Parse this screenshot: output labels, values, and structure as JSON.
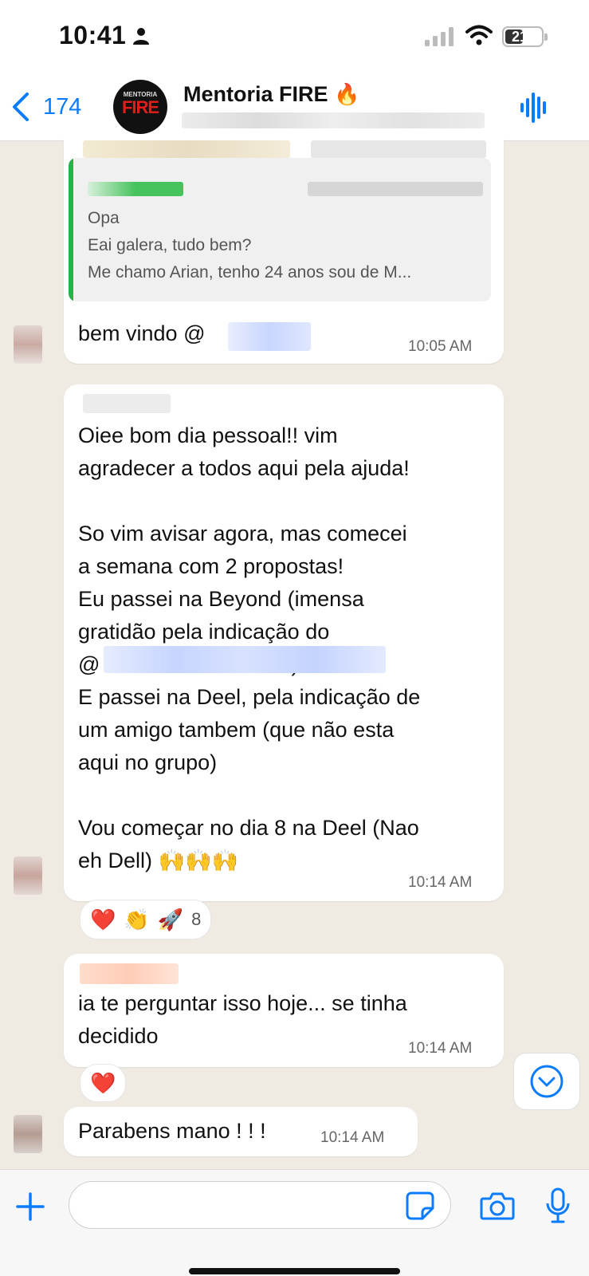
{
  "status_bar": {
    "time": "10:41",
    "battery": "21"
  },
  "header": {
    "back_count": "174",
    "avatar_top": "MENTORIA",
    "avatar_word": "FIRE",
    "group_name": "Mentoria FIRE",
    "group_emoji": "🔥"
  },
  "messages": {
    "m1": {
      "quote_lines": [
        "Opa",
        "Eai galera, tudo bem?",
        "Me chamo Arian, tenho 24 anos sou de M..."
      ],
      "text": "bem vindo @",
      "time": "10:05 AM"
    },
    "m2": {
      "text": "Oiee bom dia pessoal!! vim\nagradecer a todos aqui pela ajuda!\n\nSo vim avisar agora, mas comecei\na semana com 2 propostas!\nEu passei na Beyond (imensa\ngratidão pela indicação do\n@                                )\nE passei na Deel, pela indicação de\num amigo tambem (que não esta\naqui no grupo)\n\nVou começar no dia 8 na Deel (Nao\neh Dell) 🙌🙌🙌",
      "time": "10:14 AM",
      "reactions": [
        "❤️",
        "👏",
        "🚀"
      ],
      "reaction_count": "8"
    },
    "m3": {
      "text": "ia te perguntar isso hoje... se tinha\ndecidido",
      "time": "10:14 AM",
      "reactions": [
        "❤️"
      ]
    },
    "m4": {
      "text": "Parabens mano ! ! !",
      "time": "10:14 AM"
    }
  },
  "colors": {
    "accent": "#0a7cff",
    "chat_bg": "#efeae2",
    "quote_bar": "#25b34a"
  },
  "icons": [
    "person-icon",
    "signal-icon",
    "wifi-icon",
    "battery-icon",
    "back-chevron-icon",
    "voice-icon",
    "scroll-down-icon",
    "plus-icon",
    "sticker-icon",
    "camera-icon",
    "mic-icon"
  ]
}
